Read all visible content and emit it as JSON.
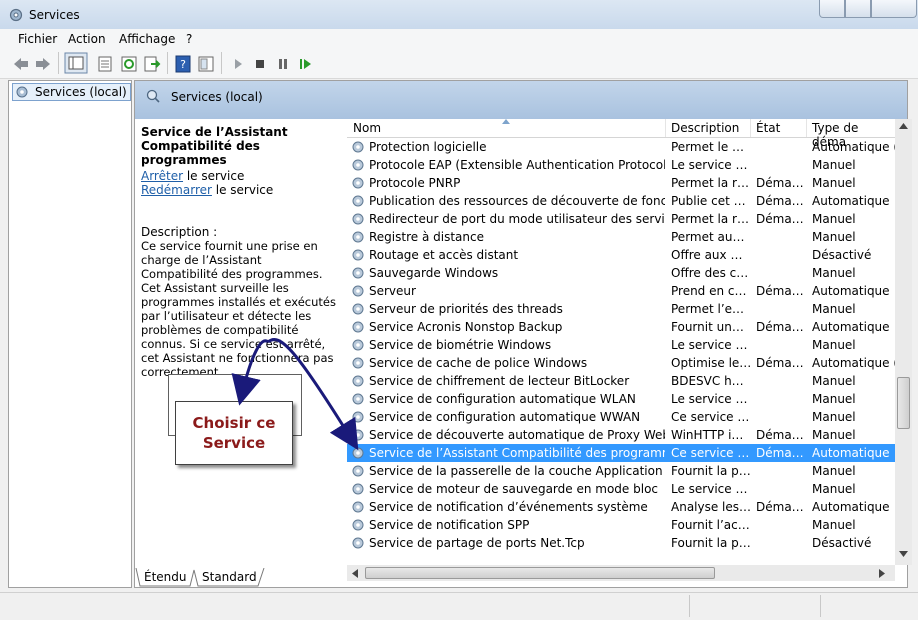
{
  "window": {
    "title": "Services"
  },
  "menu": [
    "Fichier",
    "Action",
    "Affichage",
    "?"
  ],
  "tree": {
    "root": "Services (local)"
  },
  "pane": {
    "header": "Services (local)",
    "detail_title": "Service de l’Assistant Compatibilité des programmes",
    "stop_link": "Arrêter",
    "stop_suffix": " le service",
    "restart_link": "Redémarrer",
    "restart_suffix": " le service",
    "description_label": "Description :",
    "description": "Ce service fournit une prise en charge de l’Assistant Compatibilité des programmes. Cet Assistant surveille les programmes installés et exécutés par l’utilisateur et détecte les problèmes de compatibilité connus. Si ce service est arrêté, cet Assistant ne fonctionnera pas correctement."
  },
  "columns": {
    "name": "Nom",
    "description": "Description",
    "state": "État",
    "startup": "Type de déma"
  },
  "rows": [
    {
      "name": "Protection logicielle",
      "desc": "Permet le …",
      "state": "",
      "type": "Automatique ("
    },
    {
      "name": "Protocole EAP (Extensible Authentication Protocol)",
      "desc": "Le service …",
      "state": "",
      "type": "Manuel"
    },
    {
      "name": "Protocole PNRP",
      "desc": "Permet la r…",
      "state": "Déma…",
      "type": "Manuel"
    },
    {
      "name": "Publication des ressources de découverte de foncti…",
      "desc": "Publie cet …",
      "state": "Déma…",
      "type": "Automatique"
    },
    {
      "name": "Redirecteur de port du mode utilisateur des service…",
      "desc": "Permet la r…",
      "state": "Déma…",
      "type": "Manuel"
    },
    {
      "name": "Registre à distance",
      "desc": "Permet au…",
      "state": "",
      "type": "Manuel"
    },
    {
      "name": "Routage et accès distant",
      "desc": "Offre aux …",
      "state": "",
      "type": "Désactivé"
    },
    {
      "name": "Sauvegarde Windows",
      "desc": "Offre des c…",
      "state": "",
      "type": "Manuel"
    },
    {
      "name": "Serveur",
      "desc": "Prend en c…",
      "state": "Déma…",
      "type": "Automatique"
    },
    {
      "name": "Serveur de priorités des threads",
      "desc": "Permet l’e…",
      "state": "",
      "type": "Manuel"
    },
    {
      "name": "Service Acronis Nonstop Backup",
      "desc": "Fournit un…",
      "state": "Déma…",
      "type": "Automatique"
    },
    {
      "name": "Service de biométrie Windows",
      "desc": "Le service …",
      "state": "",
      "type": "Manuel"
    },
    {
      "name": "Service de cache de police Windows",
      "desc": "Optimise le…",
      "state": "Déma…",
      "type": "Automatique ("
    },
    {
      "name": "Service de chiffrement de lecteur BitLocker",
      "desc": "BDESVC h…",
      "state": "",
      "type": "Manuel"
    },
    {
      "name": "Service de configuration automatique WLAN",
      "desc": "Le service …",
      "state": "",
      "type": "Manuel"
    },
    {
      "name": "Service de configuration automatique WWAN",
      "desc": "Ce service …",
      "state": "",
      "type": "Manuel"
    },
    {
      "name": "Service de découverte automatique de Proxy Web…",
      "desc": "WinHTTP i…",
      "state": "Déma…",
      "type": "Manuel"
    },
    {
      "name": "Service de l’Assistant Compatibilité des programmes",
      "desc": "Ce service …",
      "state": "Déma…",
      "type": "Automatique",
      "selected": true
    },
    {
      "name": "Service de la passerelle de la couche Application",
      "desc": "Fournit la p…",
      "state": "",
      "type": "Manuel"
    },
    {
      "name": "Service de moteur de sauvegarde en mode bloc",
      "desc": "Le service …",
      "state": "",
      "type": "Manuel"
    },
    {
      "name": "Service de notification d’événements système",
      "desc": "Analyse les…",
      "state": "Déma…",
      "type": "Automatique"
    },
    {
      "name": "Service de notification SPP",
      "desc": "Fournit l’ac…",
      "state": "",
      "type": "Manuel"
    },
    {
      "name": "Service de partage de ports Net.Tcp",
      "desc": "Fournit la p…",
      "state": "",
      "type": "Désactivé"
    }
  ],
  "tabs": [
    "Étendu",
    "Standard"
  ],
  "annotation": {
    "line1": "Choisir ce",
    "line2": "Service"
  },
  "colors": {
    "selection": "#3399ff",
    "header_band": "#b5cbe4",
    "link": "#1f5fa8",
    "annotation_text": "#8b1a1a",
    "arrow": "#1a1a7a"
  }
}
